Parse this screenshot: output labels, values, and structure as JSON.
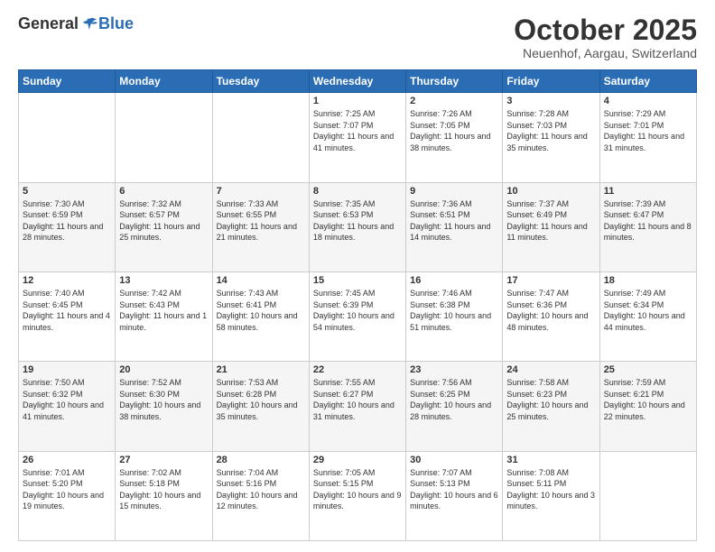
{
  "header": {
    "logo_general": "General",
    "logo_blue": "Blue",
    "month_title": "October 2025",
    "location": "Neuenhof, Aargau, Switzerland"
  },
  "days_of_week": [
    "Sunday",
    "Monday",
    "Tuesday",
    "Wednesday",
    "Thursday",
    "Friday",
    "Saturday"
  ],
  "weeks": [
    [
      {
        "day": "",
        "info": ""
      },
      {
        "day": "",
        "info": ""
      },
      {
        "day": "",
        "info": ""
      },
      {
        "day": "1",
        "info": "Sunrise: 7:25 AM\nSunset: 7:07 PM\nDaylight: 11 hours and 41 minutes."
      },
      {
        "day": "2",
        "info": "Sunrise: 7:26 AM\nSunset: 7:05 PM\nDaylight: 11 hours and 38 minutes."
      },
      {
        "day": "3",
        "info": "Sunrise: 7:28 AM\nSunset: 7:03 PM\nDaylight: 11 hours and 35 minutes."
      },
      {
        "day": "4",
        "info": "Sunrise: 7:29 AM\nSunset: 7:01 PM\nDaylight: 11 hours and 31 minutes."
      }
    ],
    [
      {
        "day": "5",
        "info": "Sunrise: 7:30 AM\nSunset: 6:59 PM\nDaylight: 11 hours and 28 minutes."
      },
      {
        "day": "6",
        "info": "Sunrise: 7:32 AM\nSunset: 6:57 PM\nDaylight: 11 hours and 25 minutes."
      },
      {
        "day": "7",
        "info": "Sunrise: 7:33 AM\nSunset: 6:55 PM\nDaylight: 11 hours and 21 minutes."
      },
      {
        "day": "8",
        "info": "Sunrise: 7:35 AM\nSunset: 6:53 PM\nDaylight: 11 hours and 18 minutes."
      },
      {
        "day": "9",
        "info": "Sunrise: 7:36 AM\nSunset: 6:51 PM\nDaylight: 11 hours and 14 minutes."
      },
      {
        "day": "10",
        "info": "Sunrise: 7:37 AM\nSunset: 6:49 PM\nDaylight: 11 hours and 11 minutes."
      },
      {
        "day": "11",
        "info": "Sunrise: 7:39 AM\nSunset: 6:47 PM\nDaylight: 11 hours and 8 minutes."
      }
    ],
    [
      {
        "day": "12",
        "info": "Sunrise: 7:40 AM\nSunset: 6:45 PM\nDaylight: 11 hours and 4 minutes."
      },
      {
        "day": "13",
        "info": "Sunrise: 7:42 AM\nSunset: 6:43 PM\nDaylight: 11 hours and 1 minute."
      },
      {
        "day": "14",
        "info": "Sunrise: 7:43 AM\nSunset: 6:41 PM\nDaylight: 10 hours and 58 minutes."
      },
      {
        "day": "15",
        "info": "Sunrise: 7:45 AM\nSunset: 6:39 PM\nDaylight: 10 hours and 54 minutes."
      },
      {
        "day": "16",
        "info": "Sunrise: 7:46 AM\nSunset: 6:38 PM\nDaylight: 10 hours and 51 minutes."
      },
      {
        "day": "17",
        "info": "Sunrise: 7:47 AM\nSunset: 6:36 PM\nDaylight: 10 hours and 48 minutes."
      },
      {
        "day": "18",
        "info": "Sunrise: 7:49 AM\nSunset: 6:34 PM\nDaylight: 10 hours and 44 minutes."
      }
    ],
    [
      {
        "day": "19",
        "info": "Sunrise: 7:50 AM\nSunset: 6:32 PM\nDaylight: 10 hours and 41 minutes."
      },
      {
        "day": "20",
        "info": "Sunrise: 7:52 AM\nSunset: 6:30 PM\nDaylight: 10 hours and 38 minutes."
      },
      {
        "day": "21",
        "info": "Sunrise: 7:53 AM\nSunset: 6:28 PM\nDaylight: 10 hours and 35 minutes."
      },
      {
        "day": "22",
        "info": "Sunrise: 7:55 AM\nSunset: 6:27 PM\nDaylight: 10 hours and 31 minutes."
      },
      {
        "day": "23",
        "info": "Sunrise: 7:56 AM\nSunset: 6:25 PM\nDaylight: 10 hours and 28 minutes."
      },
      {
        "day": "24",
        "info": "Sunrise: 7:58 AM\nSunset: 6:23 PM\nDaylight: 10 hours and 25 minutes."
      },
      {
        "day": "25",
        "info": "Sunrise: 7:59 AM\nSunset: 6:21 PM\nDaylight: 10 hours and 22 minutes."
      }
    ],
    [
      {
        "day": "26",
        "info": "Sunrise: 7:01 AM\nSunset: 5:20 PM\nDaylight: 10 hours and 19 minutes."
      },
      {
        "day": "27",
        "info": "Sunrise: 7:02 AM\nSunset: 5:18 PM\nDaylight: 10 hours and 15 minutes."
      },
      {
        "day": "28",
        "info": "Sunrise: 7:04 AM\nSunset: 5:16 PM\nDaylight: 10 hours and 12 minutes."
      },
      {
        "day": "29",
        "info": "Sunrise: 7:05 AM\nSunset: 5:15 PM\nDaylight: 10 hours and 9 minutes."
      },
      {
        "day": "30",
        "info": "Sunrise: 7:07 AM\nSunset: 5:13 PM\nDaylight: 10 hours and 6 minutes."
      },
      {
        "day": "31",
        "info": "Sunrise: 7:08 AM\nSunset: 5:11 PM\nDaylight: 10 hours and 3 minutes."
      },
      {
        "day": "",
        "info": ""
      }
    ]
  ]
}
